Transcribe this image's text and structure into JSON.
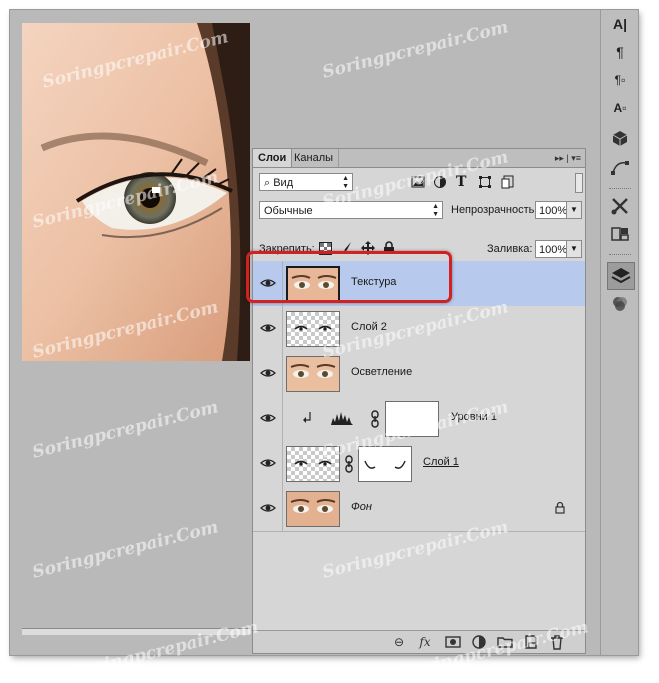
{
  "panel": {
    "tabs": [
      "Слои",
      "Каналы"
    ],
    "tab_menu_glyph": "▸▸ | ▾≡",
    "filter_kind": "Вид",
    "blend_mode": "Обычные",
    "opacity_label": "Непрозрачность:",
    "opacity_value": "100%",
    "lock_label": "Закрепить:",
    "fill_label": "Заливка:",
    "fill_value": "100%"
  },
  "layers": [
    {
      "name": "Текстура",
      "selected": true,
      "thumb": "face"
    },
    {
      "name": "Слой 2",
      "selected": false,
      "thumb": "checker-eyes"
    },
    {
      "name": "Осветление",
      "selected": false,
      "thumb": "face"
    },
    {
      "name": "Уровни 1",
      "selected": false,
      "thumb": "levels"
    },
    {
      "name": "Слой 1",
      "selected": false,
      "thumb": "checker-eyes-mask"
    },
    {
      "name": "Фон",
      "selected": false,
      "thumb": "face"
    }
  ],
  "bottom_icons": [
    "link-icon",
    "fx-icon",
    "mask-icon",
    "adjustment-icon",
    "folder-icon",
    "new-layer-icon",
    "trash-icon"
  ],
  "bottom_fx_label": "fx",
  "toolbar_icons": [
    "character-icon",
    "paragraph-icon",
    "paragraph-styles-icon",
    "character-styles-icon",
    "3d-icon",
    "path-icon",
    "tools-icon",
    "clone-source-icon",
    "layers-panel-icon",
    "channels-panel-icon"
  ],
  "watermark": "Soringpcrepair.Com",
  "colors": {
    "selected_layer": "#b7c9ec",
    "highlight": "#d32020",
    "panel_bg": "#d6d6d6"
  }
}
